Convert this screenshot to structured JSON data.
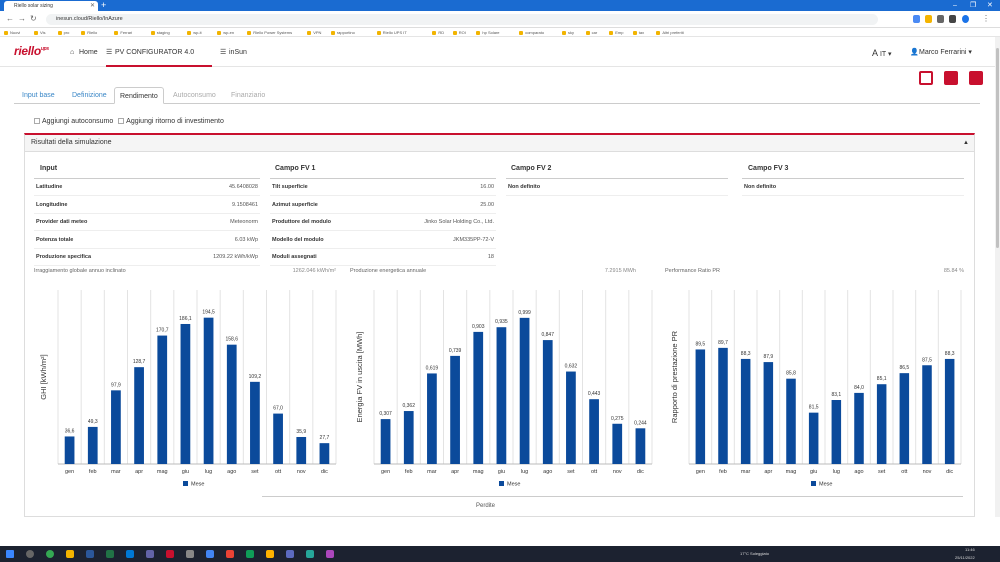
{
  "browser": {
    "tab_title": "Riello solar sizing",
    "url": "inesun.cloud/Riello/InAzure",
    "bookmarks": [
      "Nuovi",
      "Vis",
      "pro",
      "Riello",
      "Ferrari",
      "staging",
      "wp-it",
      "wp-en",
      "Riello Power Systems",
      "VPN",
      "rapportino",
      "Riello UPS IT",
      "RD",
      "ROI",
      "hp Solare",
      "comparato",
      "sky",
      "car",
      "Emp",
      "tax",
      "Altri preferiti"
    ]
  },
  "appnav": {
    "logo_main": "riello",
    "logo_sub": "ups",
    "home": "Home",
    "configurator": "PV CONFIGURATOR 4.0",
    "insun": "inSun",
    "lang": "IT",
    "user": "Marco Ferrarini"
  },
  "tabs": [
    "Input base",
    "Definizione",
    "Rendimento",
    "Autoconsumo",
    "Finanziario"
  ],
  "checks": [
    "Aggiungi autoconsumo",
    "Aggiungi ritorno di investimento"
  ],
  "panel_title": "Risultati della simulazione",
  "columns": {
    "input": {
      "title": "Input",
      "rows": [
        {
          "k": "Latitudine",
          "v": "45.6408028"
        },
        {
          "k": "Longitudine",
          "v": "9.1508461"
        },
        {
          "k": "Provider dati meteo",
          "v": "Meteonorm"
        },
        {
          "k": "Potenza totale",
          "v": "6.03 kWp"
        },
        {
          "k": "Produzione specifica",
          "v": "1209.22 kWh/kWp"
        }
      ]
    },
    "fv1": {
      "title": "Campo FV 1",
      "rows": [
        {
          "k": "Tilt superficie",
          "v": "16.00"
        },
        {
          "k": "Azimut superficie",
          "v": "25.00"
        },
        {
          "k": "Produttore del modulo",
          "v": "Jinko Solar Holding Co., Ltd."
        },
        {
          "k": "Modello del modulo",
          "v": "JKM335PP-72-V"
        },
        {
          "k": "Moduli assegnati",
          "v": "18"
        }
      ]
    },
    "fv2": {
      "title": "Campo FV 2",
      "rows": [
        {
          "k": "Non definito",
          "v": ""
        }
      ]
    },
    "fv3": {
      "title": "Campo FV 3",
      "rows": [
        {
          "k": "Non definito",
          "v": ""
        }
      ]
    }
  },
  "summary": [
    {
      "k": "Irraggiamento globale annuo inclinato",
      "v": "1262.046 kWh/m²"
    },
    {
      "k": "Produzione energetica annuale",
      "v": "7.2915 MWh"
    },
    {
      "k": "Performance Ratio PR",
      "v": "85.84 %"
    }
  ],
  "legend_label": "Mese",
  "perdite": "Perdite",
  "chart_data": [
    {
      "type": "bar",
      "categories": [
        "gen",
        "feb",
        "mar",
        "apr",
        "mag",
        "giu",
        "lug",
        "ago",
        "set",
        "ott",
        "nov",
        "dic"
      ],
      "values": [
        36.6,
        49.3,
        97.9,
        128.7,
        170.7,
        186.1,
        194.5,
        158.6,
        109.2,
        67.0,
        35.9,
        27.7
      ],
      "labels": [
        "36,6",
        "49,3",
        "97,9",
        "128,7",
        "170,7",
        "186,1",
        "194,5",
        "158,6",
        "109,2",
        "67,0",
        "35,9",
        "27,7"
      ],
      "ylabel": "GHI [kWh/m²]",
      "series_name": "Mese",
      "ymax": 210
    },
    {
      "type": "bar",
      "categories": [
        "gen",
        "feb",
        "mar",
        "apr",
        "mag",
        "giu",
        "lug",
        "ago",
        "set",
        "ott",
        "nov",
        "dic"
      ],
      "values": [
        0.307,
        0.362,
        0.619,
        0.739,
        0.903,
        0.935,
        0.999,
        0.847,
        0.632,
        0.443,
        0.275,
        0.244
      ],
      "labels": [
        "0,307",
        "0,362",
        "0,619",
        "0,739",
        "0,903",
        "0,935",
        "0,999",
        "0,847",
        "0,632",
        "0,443",
        "0,275",
        "0,244"
      ],
      "ylabel": "Energia FV in uscita [MWh]",
      "series_name": "Mese",
      "ymax": 1.08
    },
    {
      "type": "bar",
      "categories": [
        "gen",
        "feb",
        "mar",
        "apr",
        "mag",
        "giu",
        "lug",
        "ago",
        "set",
        "ott",
        "nov",
        "dic"
      ],
      "values": [
        89.5,
        89.7,
        88.3,
        87.9,
        85.8,
        81.5,
        83.1,
        84.0,
        85.1,
        86.5,
        87.5,
        88.3
      ],
      "labels": [
        "89,5",
        "89,7",
        "88,3",
        "87,9",
        "85,8",
        "81,5",
        "83,1",
        "84,0",
        "85,1",
        "86,5",
        "87,5",
        "88,3"
      ],
      "ylabel": "Rapporto di prestazione PR",
      "series_name": "Mese",
      "ymin": 75,
      "ymax": 95
    }
  ],
  "taskbar": {
    "weather": "17°C Soleggiato",
    "time": "11:46",
    "date": "25/11/2022"
  },
  "colors": {
    "accent": "#c8102e",
    "bar": "#0b4a9b",
    "link": "#3a87c7"
  }
}
